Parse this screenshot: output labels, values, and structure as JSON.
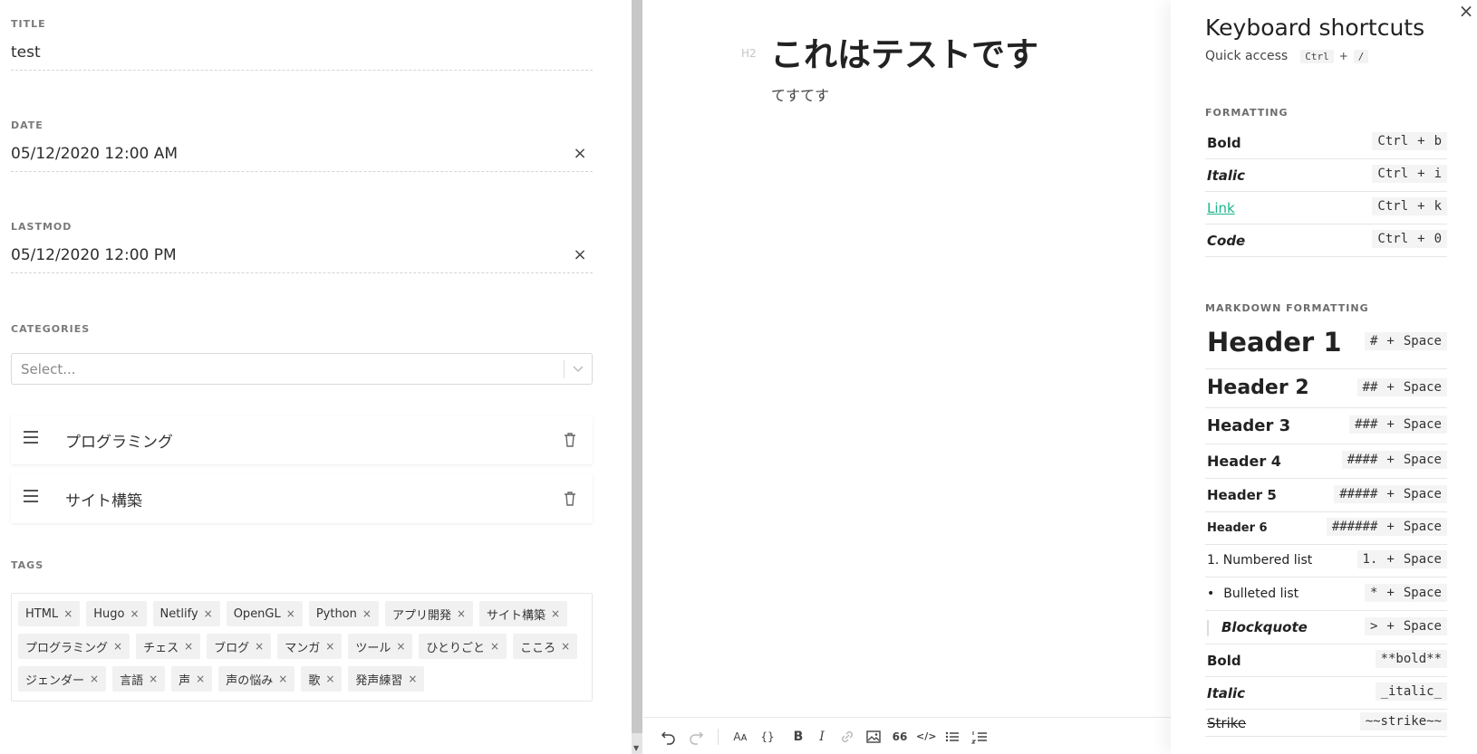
{
  "left": {
    "title_label": "TITLE",
    "title_value": "test",
    "date_label": "DATE",
    "date_value": "05/12/2020 12:00 AM",
    "lastmod_label": "LASTMOD",
    "lastmod_value": "05/12/2020 12:00 PM",
    "categories_label": "CATEGORIES",
    "categories_placeholder": "Select...",
    "categories": [
      "プログラミング",
      "サイト構築"
    ],
    "tags_label": "TAGS",
    "tag_rows": [
      [
        "HTML",
        "Hugo",
        "Netlify",
        "OpenGL",
        "Python",
        "アプリ開発",
        "サイト構築"
      ],
      [
        "プログラミング",
        "チェス",
        "ブログ",
        "マンガ",
        "ツール",
        "ひとりごと",
        "こころ"
      ],
      [
        "ジェンダー",
        "言語",
        "声",
        "声の悩み",
        "歌",
        "発声練習"
      ]
    ],
    "clear_glyph": "×",
    "tag_remove_glyph": "×"
  },
  "editor": {
    "heading_marker": "H2",
    "heading": "これはテストです",
    "paragraph": "てすてす",
    "toolbar": {
      "undo_icon": "undo-icon",
      "redo_icon": "redo-icon",
      "text_size_label": "Aᴀ",
      "code_block_label": "{}",
      "bold_label": "B",
      "italic_label": "I",
      "quote_label": "66",
      "code_label": "</>"
    }
  },
  "shortcuts": {
    "close_glyph": "×",
    "title": "Keyboard shortcuts",
    "quick_access_label": "Quick access",
    "quick_access_keys": [
      "Ctrl",
      "/"
    ],
    "plus": "+",
    "formatting_label": "FORMATTING",
    "formatting": [
      {
        "name": "Bold",
        "keys": [
          "Ctrl",
          "b"
        ],
        "style": "bold"
      },
      {
        "name": "Italic",
        "keys": [
          "Ctrl",
          "i"
        ],
        "style": "italic"
      },
      {
        "name": "Link",
        "keys": [
          "Ctrl",
          "k"
        ],
        "style": "link"
      },
      {
        "name": "Code",
        "keys": [
          "Ctrl",
          "0"
        ],
        "style": "code"
      }
    ],
    "markdown_label": "MARKDOWN FORMATTING",
    "markdown": [
      {
        "name": "Header 1",
        "keys": [
          "#",
          "Space"
        ],
        "style": "h1"
      },
      {
        "name": "Header 2",
        "keys": [
          "##",
          "Space"
        ],
        "style": "h2"
      },
      {
        "name": "Header 3",
        "keys": [
          "###",
          "Space"
        ],
        "style": "h3"
      },
      {
        "name": "Header 4",
        "keys": [
          "####",
          "Space"
        ],
        "style": "h4"
      },
      {
        "name": "Header 5",
        "keys": [
          "#####",
          "Space"
        ],
        "style": "h5"
      },
      {
        "name": "Header 6",
        "keys": [
          "######",
          "Space"
        ],
        "style": "h6"
      },
      {
        "name": "1. Numbered list",
        "keys": [
          "1.",
          "Space"
        ],
        "style": "plain"
      },
      {
        "name": "Bulleted list",
        "keys": [
          "*",
          "Space"
        ],
        "style": "bullet"
      },
      {
        "name": "Blockquote",
        "keys": [
          ">",
          "Space"
        ],
        "style": "quote"
      },
      {
        "name": "Bold",
        "keys": [
          "**bold**"
        ],
        "style": "bold"
      },
      {
        "name": "Italic",
        "keys": [
          "_italic_"
        ],
        "style": "italic"
      },
      {
        "name": "Strike",
        "keys": [
          "~~strike~~"
        ],
        "style": "strike"
      }
    ]
  },
  "colors": {
    "link": "#1bb68a",
    "accent_text": "#222222"
  }
}
